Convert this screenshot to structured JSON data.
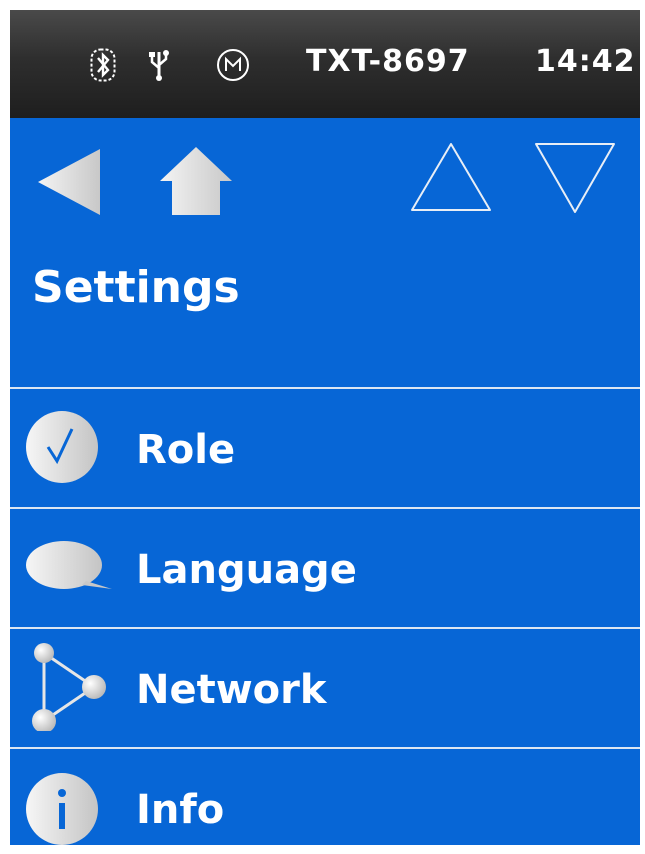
{
  "status_bar": {
    "icons": [
      "bluetooth-icon",
      "usb-icon",
      "motor-icon"
    ],
    "device_name": "TXT-8697",
    "time": "14:42"
  },
  "navigation": {
    "buttons": [
      "back-arrow-icon",
      "home-icon",
      "scroll-up-icon",
      "scroll-down-icon"
    ]
  },
  "page": {
    "title": "Settings"
  },
  "menu": {
    "items": [
      {
        "label": "Role",
        "icon": "check-icon"
      },
      {
        "label": "Language",
        "icon": "speech-bubble-icon"
      },
      {
        "label": "Network",
        "icon": "network-icon"
      },
      {
        "label": "Info",
        "icon": "info-icon"
      }
    ]
  },
  "colors": {
    "accent": "#0766d6",
    "status_bar": "#2e2e2e",
    "divider": "#dce6f3",
    "text": "#ffffff"
  }
}
